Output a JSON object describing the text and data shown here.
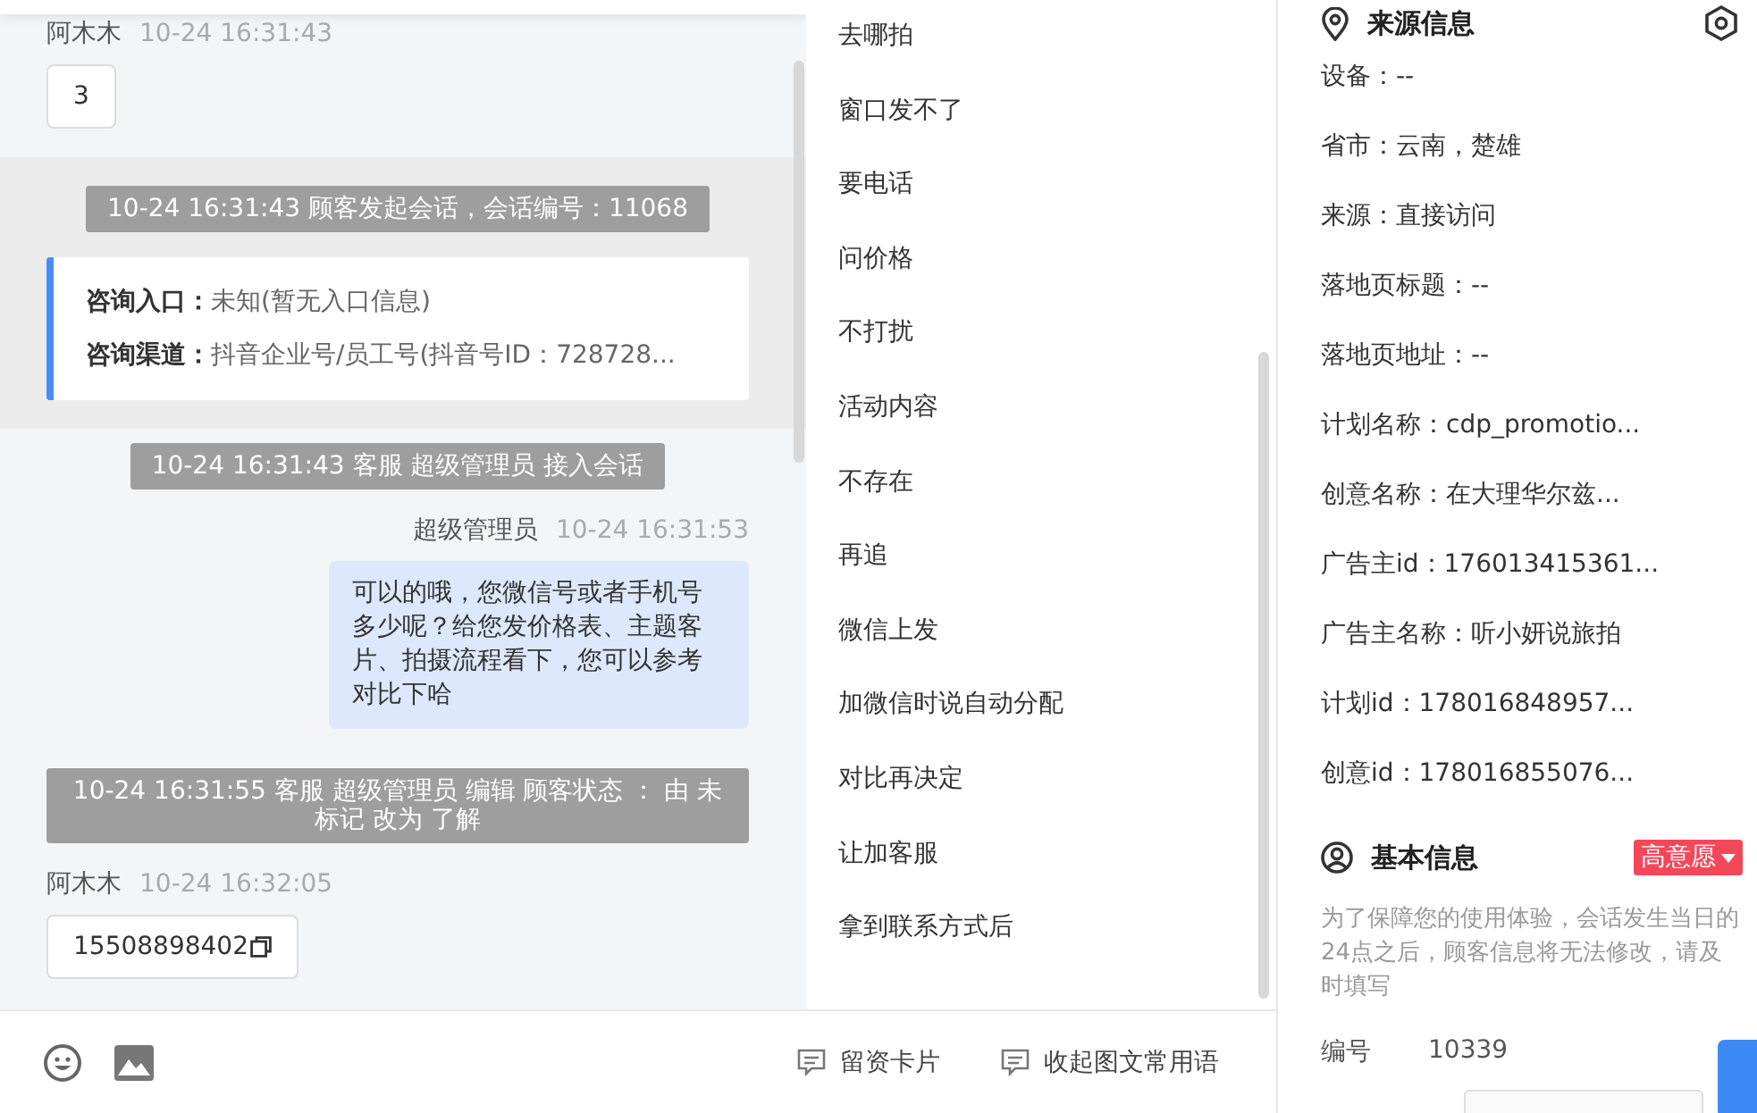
{
  "chat": {
    "messages": [
      {
        "kind": "customer",
        "name": "阿木木",
        "time": "10-24 16:31:43",
        "text": "3",
        "copy": false
      },
      {
        "kind": "session_start",
        "text": "10-24 16:31:43 顾客发起会话，会话编号：11068",
        "rows": [
          {
            "label": "咨询入口：",
            "value": "未知(暂无入口信息)"
          },
          {
            "label": "咨询渠道：",
            "value": "抖音企业号/员工号(抖音号ID：728728..."
          }
        ]
      },
      {
        "kind": "system",
        "text": "10-24 16:31:43 客服 超级管理员 接入会话"
      },
      {
        "kind": "agent",
        "name": "超级管理员",
        "time": "10-24 16:31:53",
        "text": "可以的哦，您微信号或者手机号多少呢？给您发价格表、主题客片、拍摄流程看下，您可以参考对比下哈"
      },
      {
        "kind": "system",
        "text": "10-24 16:31:55 客服 超级管理员 编辑 顾客状态 ： 由 未标记 改为 了解"
      },
      {
        "kind": "customer",
        "name": "阿木木",
        "time": "10-24 16:32:05",
        "text": "15508898402",
        "copy": true
      }
    ]
  },
  "phrases": [
    "去哪拍",
    "窗口发不了",
    "要电话",
    "问价格",
    "不打扰",
    "活动内容",
    "不存在",
    "再追",
    "微信上发",
    "加微信时说自动分配",
    "对比再决定",
    "让加客服",
    "拿到联系方式后"
  ],
  "toolbar": {
    "actions": [
      "留资卡片",
      "收起图文常用语"
    ]
  },
  "source_info": {
    "title": "来源信息",
    "items": [
      "设备：--",
      "省市：云南，楚雄",
      "来源：直接访问",
      "落地页标题：--",
      "落地页地址：--",
      "计划名称：cdp_promotio...",
      "创意名称：在大理华尔兹...",
      "广告主id：176013415361...",
      "广告主名称：听小妍说旅拍",
      "计划id：178016848957...",
      "创意id：178016855076..."
    ]
  },
  "basic_info": {
    "title": "基本信息",
    "intent": {
      "label": "高意愿",
      "color": "#f5475a"
    },
    "note": "为了保障您的使用体验，会话发生当日的24点之后，顾客信息将无法修改，请及时填写",
    "fields": [
      {
        "label": "编号",
        "value": "10339"
      }
    ]
  }
}
